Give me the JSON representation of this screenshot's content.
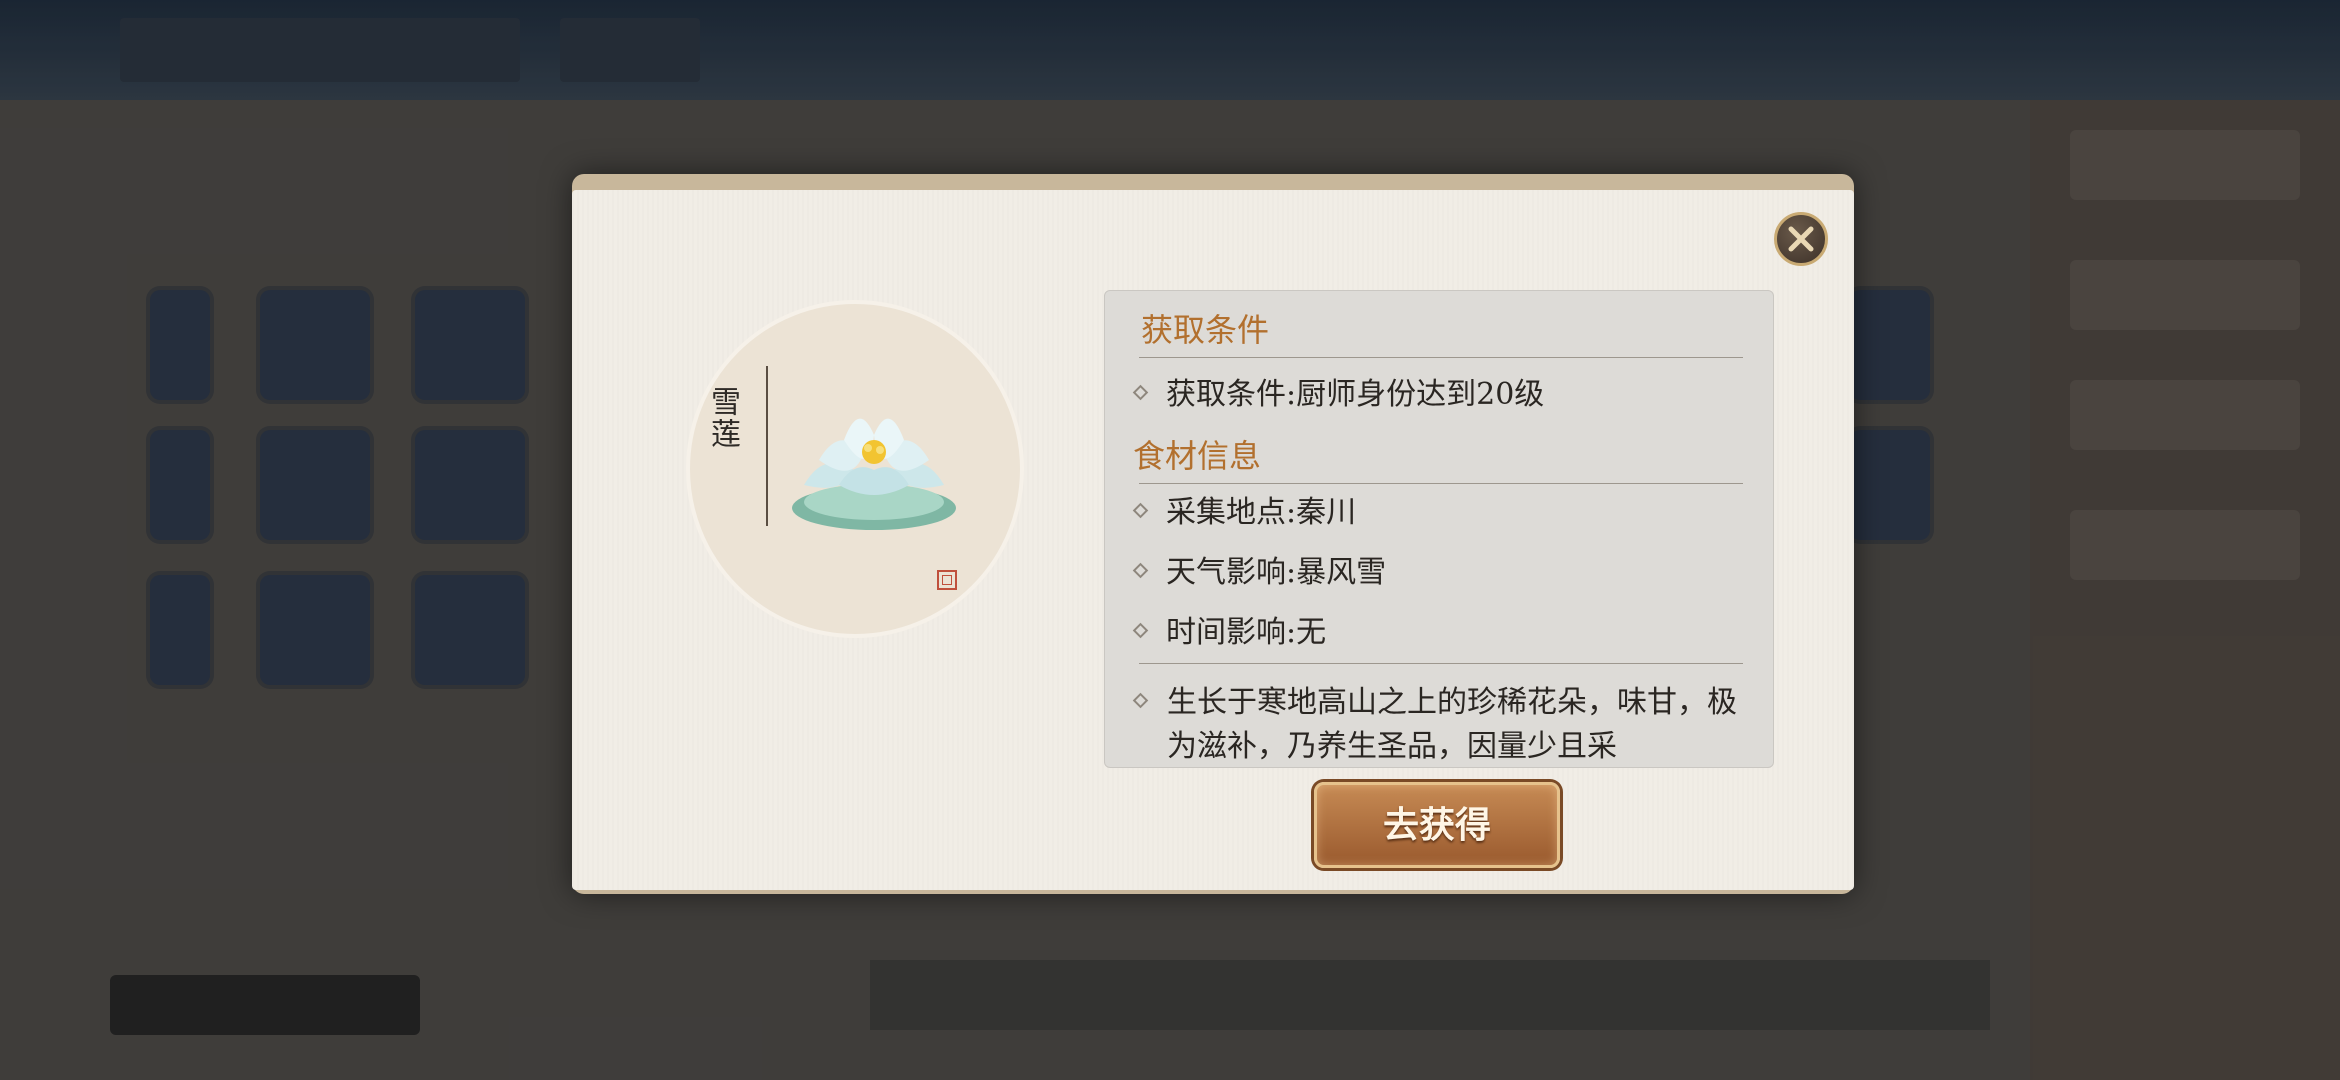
{
  "item": {
    "name": "雪莲"
  },
  "conditions": {
    "title": "获取条件",
    "text": "获取条件:厨师身份达到20级"
  },
  "ingredient_info": {
    "title": "食材信息",
    "location": "采集地点:秦川",
    "weather": "天气影响:暴风雪",
    "time": "时间影响:无",
    "description": "生长于寒地高山之上的珍稀花朵，味甘，极为滋补，乃养生圣品，因量少且采"
  },
  "buttons": {
    "get": "去获得"
  },
  "icons": {
    "close": "close-x-icon",
    "bullet": "diamond-bullet-icon"
  },
  "colors": {
    "section_title": "#b2702e",
    "button": "#b27443",
    "panel_bg": "#f1ede6"
  }
}
